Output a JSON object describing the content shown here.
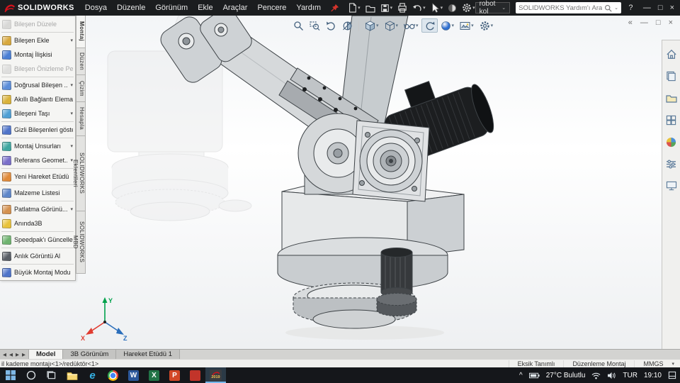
{
  "icons": {
    "caret_down": "▾",
    "caret_small": "⌄",
    "minimize": "—",
    "maximize": "□",
    "close": "×",
    "collapse": "«",
    "tab_prev": "◀",
    "tab_next": "▶",
    "tray_caret": "^",
    "help": "?"
  },
  "titlebar": {
    "logo_text": "SOLIDWORKS",
    "menus": [
      "Dosya",
      "Düzenle",
      "Görünüm",
      "Ekle",
      "Araçlar",
      "Pencere",
      "Yardım"
    ],
    "search_scope": "robot kol",
    "help_search_placeholder": "SOLIDWORKS Yardım'ı Ara"
  },
  "command_panel": {
    "items": [
      {
        "label": "Bileşen Düzele"
      },
      {
        "label": "Bileşen Ekle"
      },
      {
        "label": "Montaj İlişkisi"
      },
      {
        "label": "Bileşen Önizleme Pe..."
      },
      {
        "label": "Doğrusal Bileşen ..."
      },
      {
        "label": "Akıllı Bağlantı Elema..."
      },
      {
        "label": "Bileşeni Taşı"
      },
      {
        "label": "Gizli Bileşenleri göster"
      },
      {
        "label": "Montaj Unsurları"
      },
      {
        "label": "Referans Geomet..."
      },
      {
        "label": "Yeni Hareket Etüdü"
      },
      {
        "label": "Malzeme Listesi"
      },
      {
        "label": "Patlatma Görünü..."
      },
      {
        "label": "Anında3B"
      },
      {
        "label": "Speedpak'ı Güncelle"
      },
      {
        "label": "Anlık Görüntü Al"
      },
      {
        "label": "Büyük Montaj Modu"
      }
    ]
  },
  "side_tabs": [
    {
      "label": "Montaj"
    },
    {
      "label": "Düzen"
    },
    {
      "label": "Çizim"
    },
    {
      "label": "Hesapla"
    },
    {
      "label": "SOLIDWORKS Eklentileri"
    },
    {
      "label": "SOLIDWORKS MBD"
    }
  ],
  "viewport": {
    "triad": {
      "x": "X",
      "y": "Y",
      "z": "Z"
    }
  },
  "doc_tabs": [
    {
      "label": "Model"
    },
    {
      "label": "3B Görünüm"
    },
    {
      "label": "Hareket Etüdü 1"
    }
  ],
  "statusbar": {
    "left_text": "il kademe montajı<1>/redüktör<1>",
    "state": "Eksik Tanımlı",
    "mode": "Düzenleme Montaj",
    "units": "MMGS"
  },
  "taskbar": {
    "weather": "27°C Bulutlu",
    "language": "TUR",
    "time": "19:10",
    "sw_year": "2019",
    "edge_letter": "e",
    "word_letter": "W",
    "excel_letter": "X",
    "powerpoint_letter": "P"
  }
}
